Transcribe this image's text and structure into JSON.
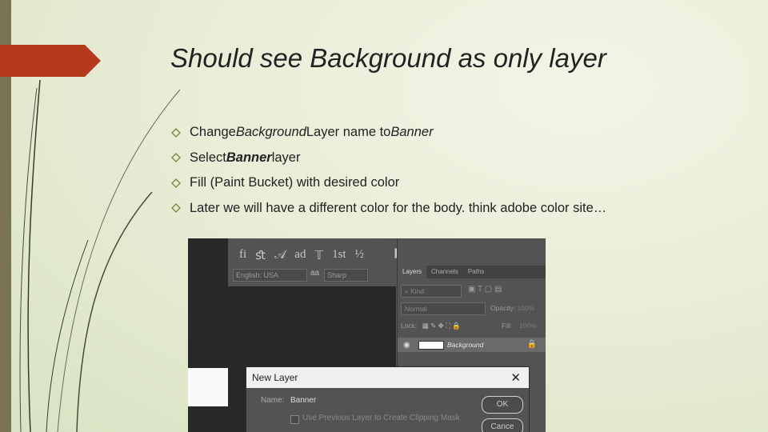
{
  "slide": {
    "title": "Should see Background as only layer",
    "bullets": [
      {
        "pre": "Change ",
        "em1": "Background",
        "mid": " Layer name to ",
        "em2": "Banner",
        "post": ""
      },
      {
        "pre": "Select ",
        "em1": "Banner",
        "mid": " layer",
        "em2": "",
        "post": ""
      },
      {
        "pre": "Fill (Paint Bucket) with desired color",
        "em1": "",
        "mid": "",
        "em2": "",
        "post": ""
      },
      {
        "pre": "Later we will have a different color for the body. think adobe color site…",
        "em1": "",
        "mid": "",
        "em2": "",
        "post": ""
      }
    ]
  },
  "colors": {
    "accent_red": "#b5381c",
    "sidebar": "#7a7353",
    "bullet": "#7f8a40"
  },
  "screenshot": {
    "glyphs": [
      "fi",
      "ﬆ",
      "𝒜",
      "ad",
      "𝕋",
      "1st",
      "½"
    ],
    "language": "English: USA",
    "aa": "aa",
    "antialias": "Sharp",
    "tabs": [
      "Layers",
      "Channels",
      "Paths"
    ],
    "kind": "Kind",
    "blend_mode": "Normal",
    "opacity_label": "Opacity:",
    "opacity_value": "100%",
    "lock_label": "Lock:",
    "fill_label": "Fill:",
    "fill_value": "100%",
    "layer_name": "Background",
    "dialog": {
      "title": "New Layer",
      "name_label": "Name:",
      "name_value": "Banner",
      "checkbox_label": "Use Previous Layer to Create Clipping Mask",
      "ok": "OK",
      "cancel": "Cance"
    }
  }
}
